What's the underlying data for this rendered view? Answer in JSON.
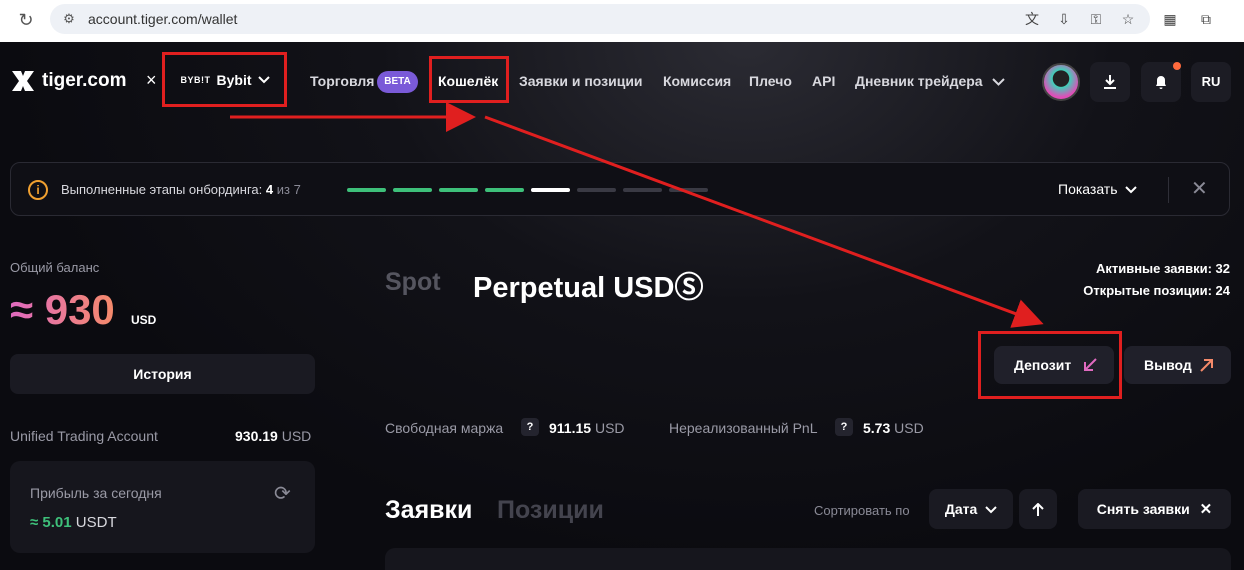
{
  "browser": {
    "url": "account.tiger.com/wallet",
    "icons": [
      "reload-icon",
      "site-settings-icon",
      "translate-icon",
      "install-icon",
      "password-key-icon",
      "bookmark-star-icon",
      "qr-extension-icon",
      "extensions-puzzle-icon"
    ]
  },
  "header": {
    "logo_text": "tiger.com",
    "separator": "×",
    "exchange_brand": "BYB!T",
    "exchange_name": "Bybit",
    "nav": {
      "trading": "Торговля",
      "trading_badge": "BETA",
      "wallet": "Кошелёк",
      "orders_positions": "Заявки и позиции",
      "commission": "Комиссия",
      "leverage": "Плечо",
      "api": "API",
      "journal": "Дневник трейдера"
    },
    "language": "RU"
  },
  "onboarding": {
    "text": "Выполненные этапы онбординга:",
    "done": "4",
    "of_label": "из",
    "total": "7",
    "completed_steps": 4,
    "current_step": 5,
    "steps_count": 8,
    "show_label": "Показать"
  },
  "balance": {
    "label": "Общий баланс",
    "amount": "≈ 930",
    "unit": "USD",
    "history_button": "История",
    "account_label": "Unified Trading Account",
    "account_value": "930.19",
    "account_unit": "USD",
    "profit_label": "Прибыль за сегодня",
    "profit_value": "≈ 5.01",
    "profit_unit": "USDT"
  },
  "main": {
    "tab_spot": "Spot",
    "tab_perpetual": "Perpetual USDⓈ",
    "active_orders": "Активные заявки: 32",
    "open_positions": "Открытые позиции: 24",
    "deposit_button": "Депозит",
    "withdraw_button": "Вывод",
    "free_margin_label": "Свободная маржа",
    "free_margin_value": "911.15",
    "free_margin_unit": "USD",
    "unrealized_label": "Нереализованный PnL",
    "unrealized_value": "5.73",
    "unrealized_unit": "USD",
    "help_mark": "?",
    "orders_title": "Заявки",
    "positions_title": "Позиции",
    "sort_label": "Сортировать по",
    "sort_value": "Дата",
    "cancel_orders_button": "Снять заявки"
  },
  "annotation_color": "#e01f1f"
}
